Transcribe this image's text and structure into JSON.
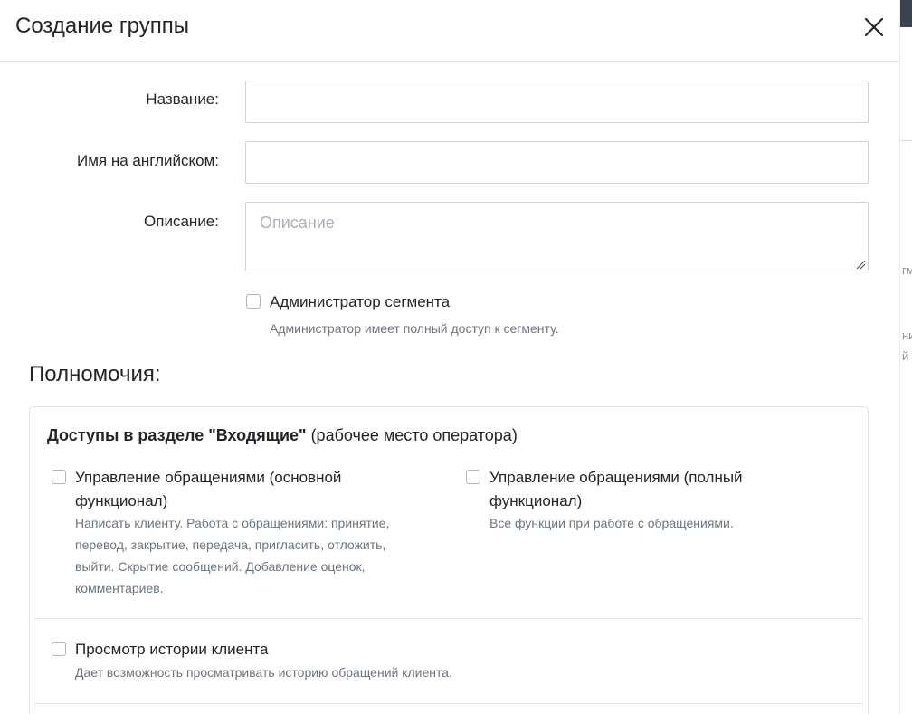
{
  "modal": {
    "title": "Создание группы"
  },
  "form": {
    "name_label": "Название:",
    "name_value": "",
    "english_name_label": "Имя на английском:",
    "english_name_value": "",
    "description_label": "Описание:",
    "description_placeholder": "Описание",
    "description_value": ""
  },
  "admin": {
    "label": "Администратор сегмента",
    "help": "Администратор имеет полный доступ к сегменту.",
    "checked": false
  },
  "permissions": {
    "title": "Полномочия:",
    "section_heading_bold": "Доступы в разделе \"Входящие\"",
    "section_heading_rest": " (рабочее место оператора)",
    "items": [
      {
        "label_line1": "Управление обращениями (основной",
        "label_line2": "функционал)",
        "help_lines": [
          "Написать клиенту. Работа с обращениями: принятие,",
          "перевод, закрытие, передача, пригласить, отложить,",
          "выйти. Скрытие сообщений. Добавление оценок,",
          "комментариев."
        ],
        "checked": false
      },
      {
        "label_line1": "Управление обращениями (полный",
        "label_line2": "функционал)",
        "help_lines": [
          "Все функции при работе с обращениями."
        ],
        "checked": false
      },
      {
        "label_line1": "Просмотр истории клиента",
        "help_lines": [
          "Дает возможность просматривать историю обращений клиента."
        ],
        "checked": false
      }
    ]
  },
  "backdrop": {
    "fragments": [
      "гм",
      "ни",
      "й г"
    ]
  },
  "colors": {
    "border": "#ced4da",
    "muted_text": "#6c757d",
    "header_dark": "#3a4450"
  }
}
